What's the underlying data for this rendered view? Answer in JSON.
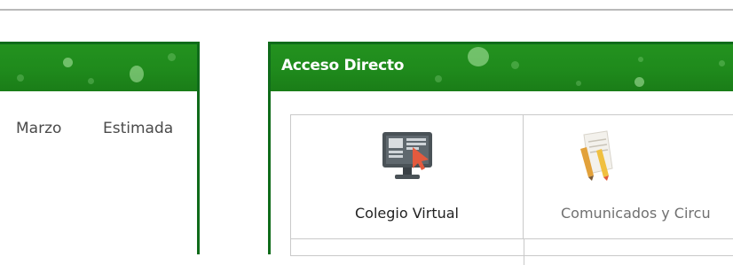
{
  "panels": {
    "left": {
      "title": "",
      "columns": [
        "Marzo",
        "Estimada"
      ]
    },
    "right": {
      "title": "Acceso Directo",
      "shortcuts": [
        {
          "label": "Colegio Virtual",
          "icon": "virtual-classroom-monitor-icon"
        },
        {
          "label": "Comunicados y Circu",
          "icon": "notepad-pencil-icon"
        }
      ]
    }
  },
  "colors": {
    "header_green": "#1f8a1c",
    "border_green": "#0f6b1a",
    "text_dark": "#222222",
    "text_muted": "#707070"
  }
}
